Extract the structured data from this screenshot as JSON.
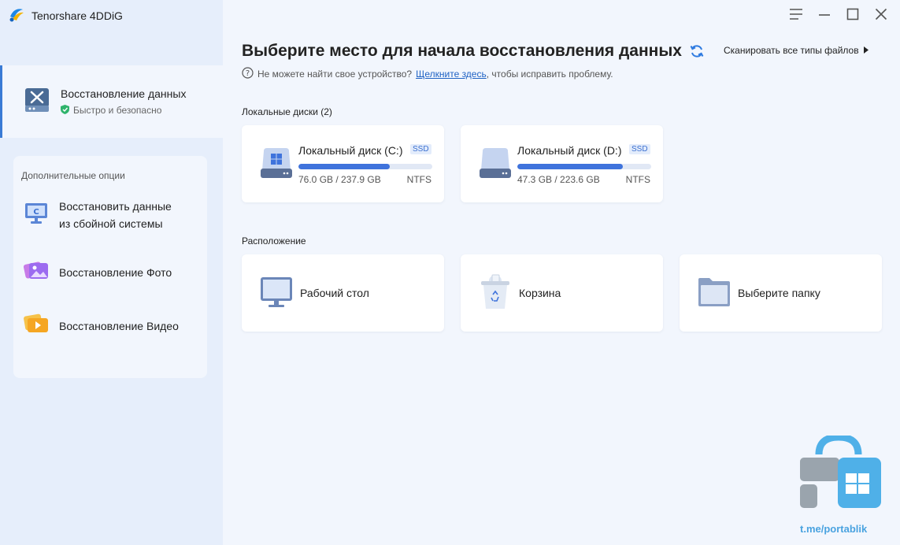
{
  "app": {
    "name": "Tenorshare 4DDiG",
    "logo_icon": "4ddig-logo-icon"
  },
  "sidebar": {
    "main_item": {
      "title": "Восстановление данных",
      "subtitle": "Быстро и безопасно",
      "icon": "tools-drive-icon"
    },
    "extra_section_title": "Дополнительные опции",
    "extra_items": [
      {
        "line1": "Восстановить данные",
        "line2": "из сбойной системы",
        "icon": "crashed-pc-icon"
      },
      {
        "label": "Восстановление Фото",
        "icon": "photo-icon"
      },
      {
        "label": "Восстановление Видео",
        "icon": "video-icon"
      }
    ]
  },
  "window_controls": [
    "menu-icon",
    "minimize-icon",
    "maximize-icon",
    "close-icon"
  ],
  "header": {
    "title": "Выберите место для начала восстановления данных",
    "scan_all": "Сканировать все типы файлов",
    "help_prefix": "Не можете найти свое устройство?",
    "help_link": "Щелкните здесь",
    "help_suffix": ", чтобы исправить проблему."
  },
  "local_disks": {
    "label": "Локальные диски (2)",
    "items": [
      {
        "name": "Локальный диск (C:)",
        "badge": "SSD",
        "used": "76.0 GB",
        "total": "237.9 GB",
        "size_text": "76.0 GB / 237.9 GB",
        "fs": "NTFS",
        "usage_fraction": 0.68
      },
      {
        "name": "Локальный диск (D:)",
        "badge": "SSD",
        "used": "47.3 GB",
        "total": "223.6 GB",
        "size_text": "47.3 GB / 223.6 GB",
        "fs": "NTFS",
        "usage_fraction": 0.79
      }
    ]
  },
  "locations": {
    "label": "Расположение",
    "items": [
      {
        "label": "Рабочий стол",
        "icon": "desktop-monitor-icon"
      },
      {
        "label": "Корзина",
        "icon": "recycle-bin-icon"
      },
      {
        "label": "Выберите папку",
        "icon": "folder-icon"
      }
    ]
  },
  "watermark": {
    "text": "t.me/portablik",
    "icon": "portablik-logo-icon"
  },
  "colors": {
    "accent": "#3f73dc",
    "link": "#1f62c4",
    "sidebar_bg": "#e6eefb",
    "content_bg": "#f2f6fd"
  }
}
